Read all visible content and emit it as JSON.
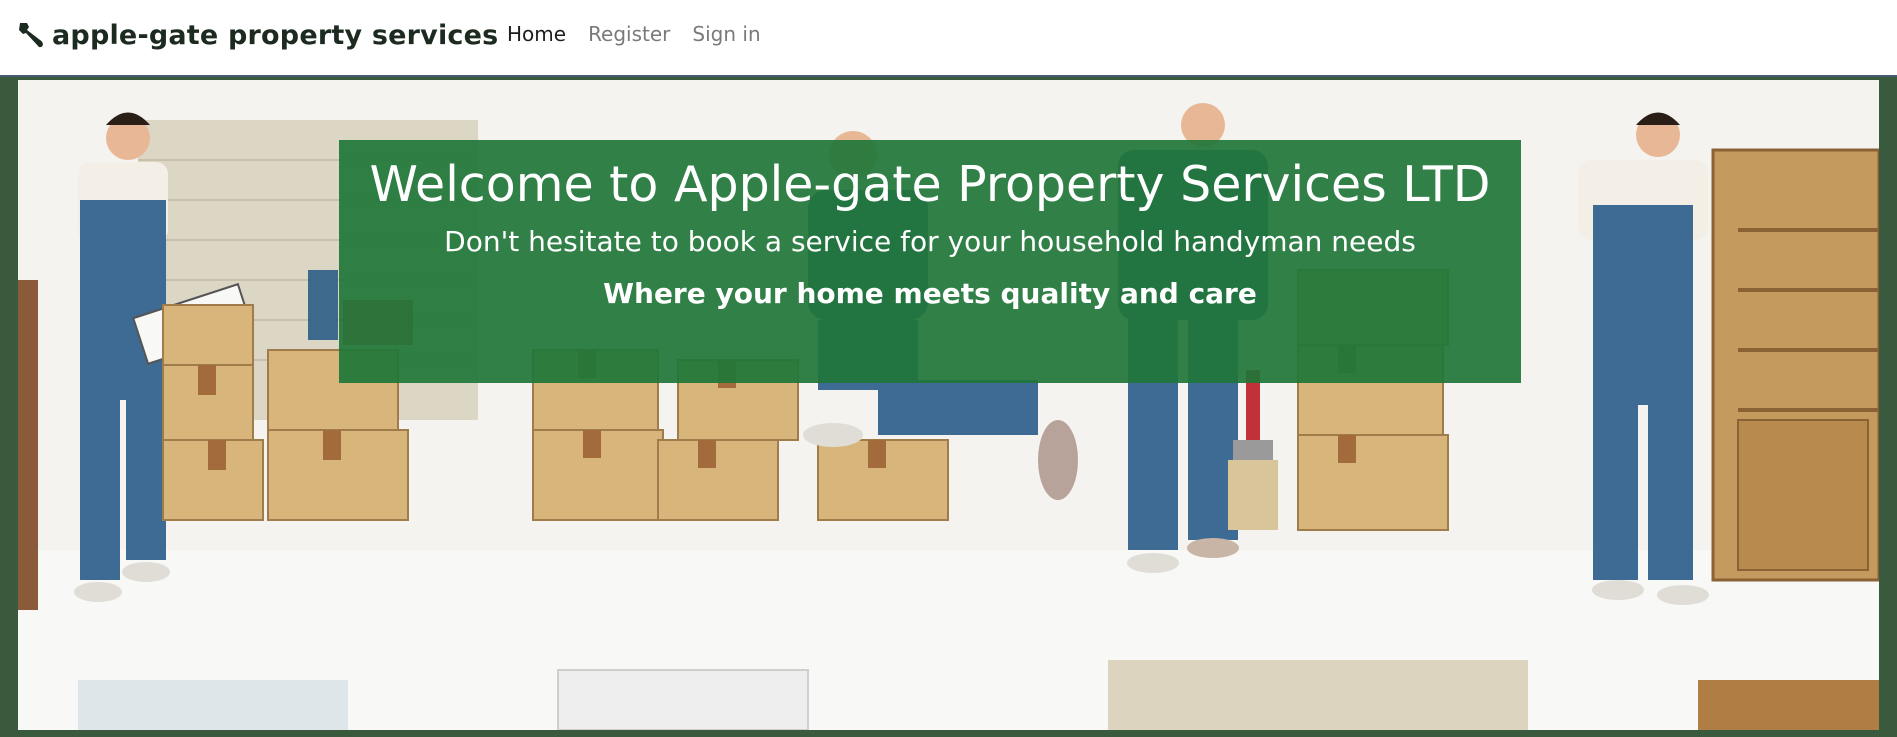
{
  "navbar": {
    "brand": {
      "icon": "wrench-icon",
      "label": "apple-gate property services"
    },
    "links": [
      {
        "label": "Home",
        "active": true
      },
      {
        "label": "Register",
        "active": false
      },
      {
        "label": "Sign in",
        "active": false
      }
    ]
  },
  "hero": {
    "image": "handymen-moving-boxes-illustration",
    "title": "Welcome to Apple-gate Property Services LTD",
    "subtitle": "Don't hesitate to book a service for your household handyman needs",
    "tagline": "Where your home meets quality and care"
  },
  "colors": {
    "banner": "#1f7638",
    "hero_border": "#3a5a3e",
    "nav_active": "#1d1d1d",
    "nav_inactive": "#7a7a7a"
  }
}
